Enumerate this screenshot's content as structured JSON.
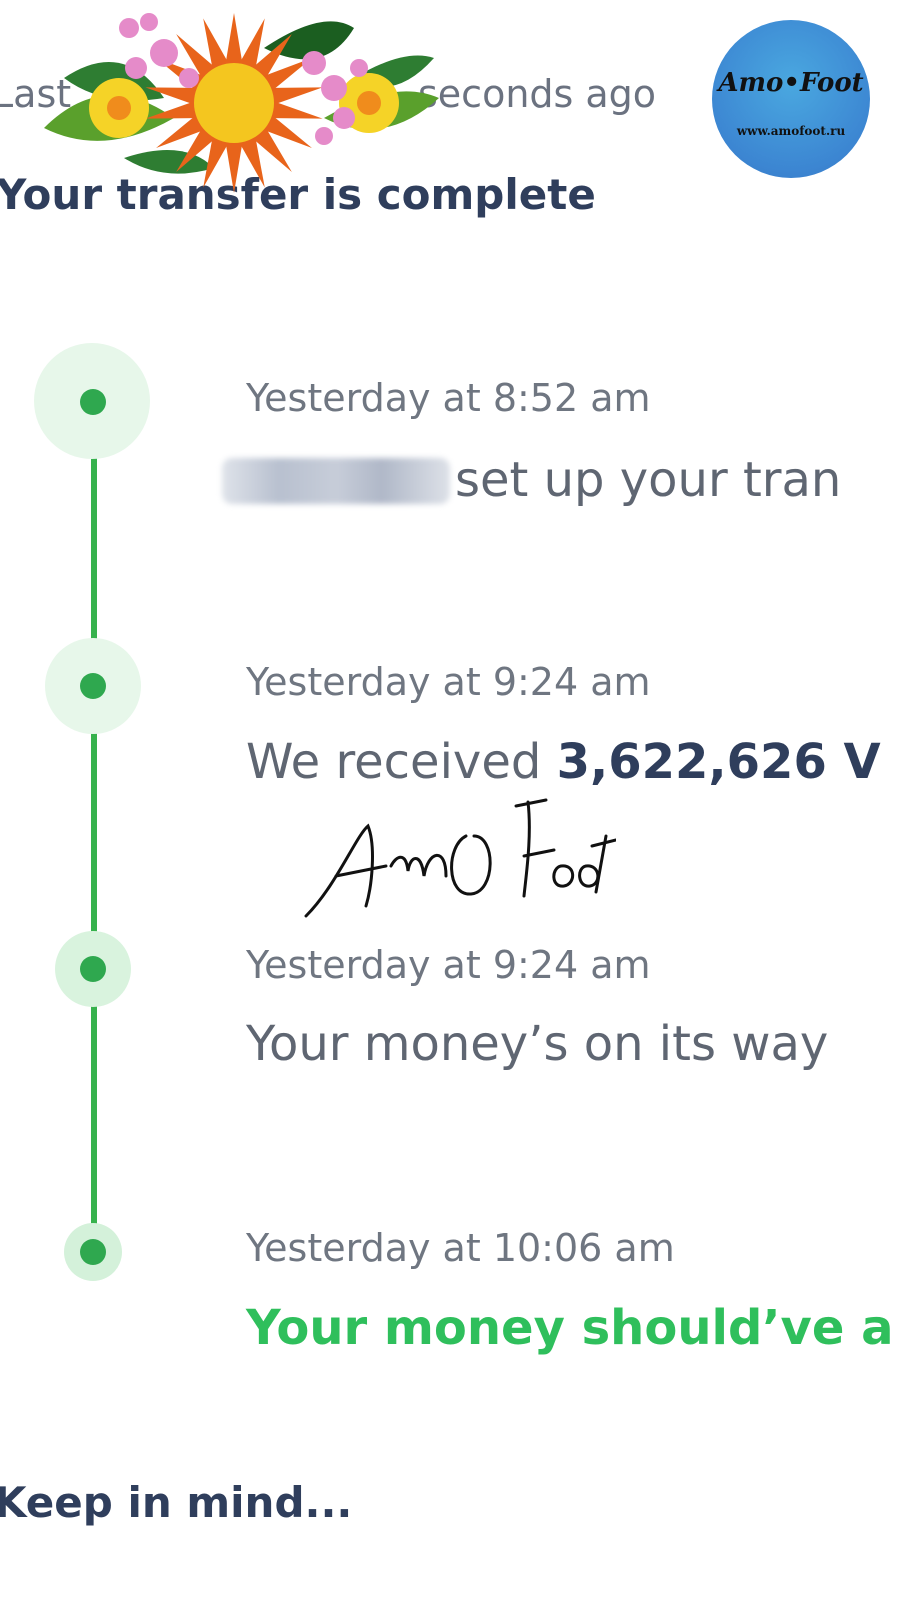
{
  "header": {
    "status_prefix": "Last",
    "status_suffix": "seconds ago",
    "title": "Your transfer is complete"
  },
  "watermark": {
    "logo_name": "Amo•Foot",
    "logo_url": "www.amofoot.ru",
    "signature": "AmO Foot"
  },
  "timeline": [
    {
      "time": "Yesterday at 8:52 am",
      "text": "set up your tran",
      "sender_hidden": true
    },
    {
      "time": "Yesterday at 9:24 am",
      "text_prefix": "We received ",
      "amount": "3,622,626 V"
    },
    {
      "time": "Yesterday at 9:24 am",
      "text": "Your money’s on its way"
    },
    {
      "time": "Yesterday at 10:06 am",
      "text": "Your money should’ve a"
    }
  ],
  "footer": {
    "heading": "Keep in mind..."
  },
  "colors": {
    "accent_green": "#37b24d",
    "heading_navy": "#2f3e5c",
    "muted_text": "#6f7681"
  }
}
